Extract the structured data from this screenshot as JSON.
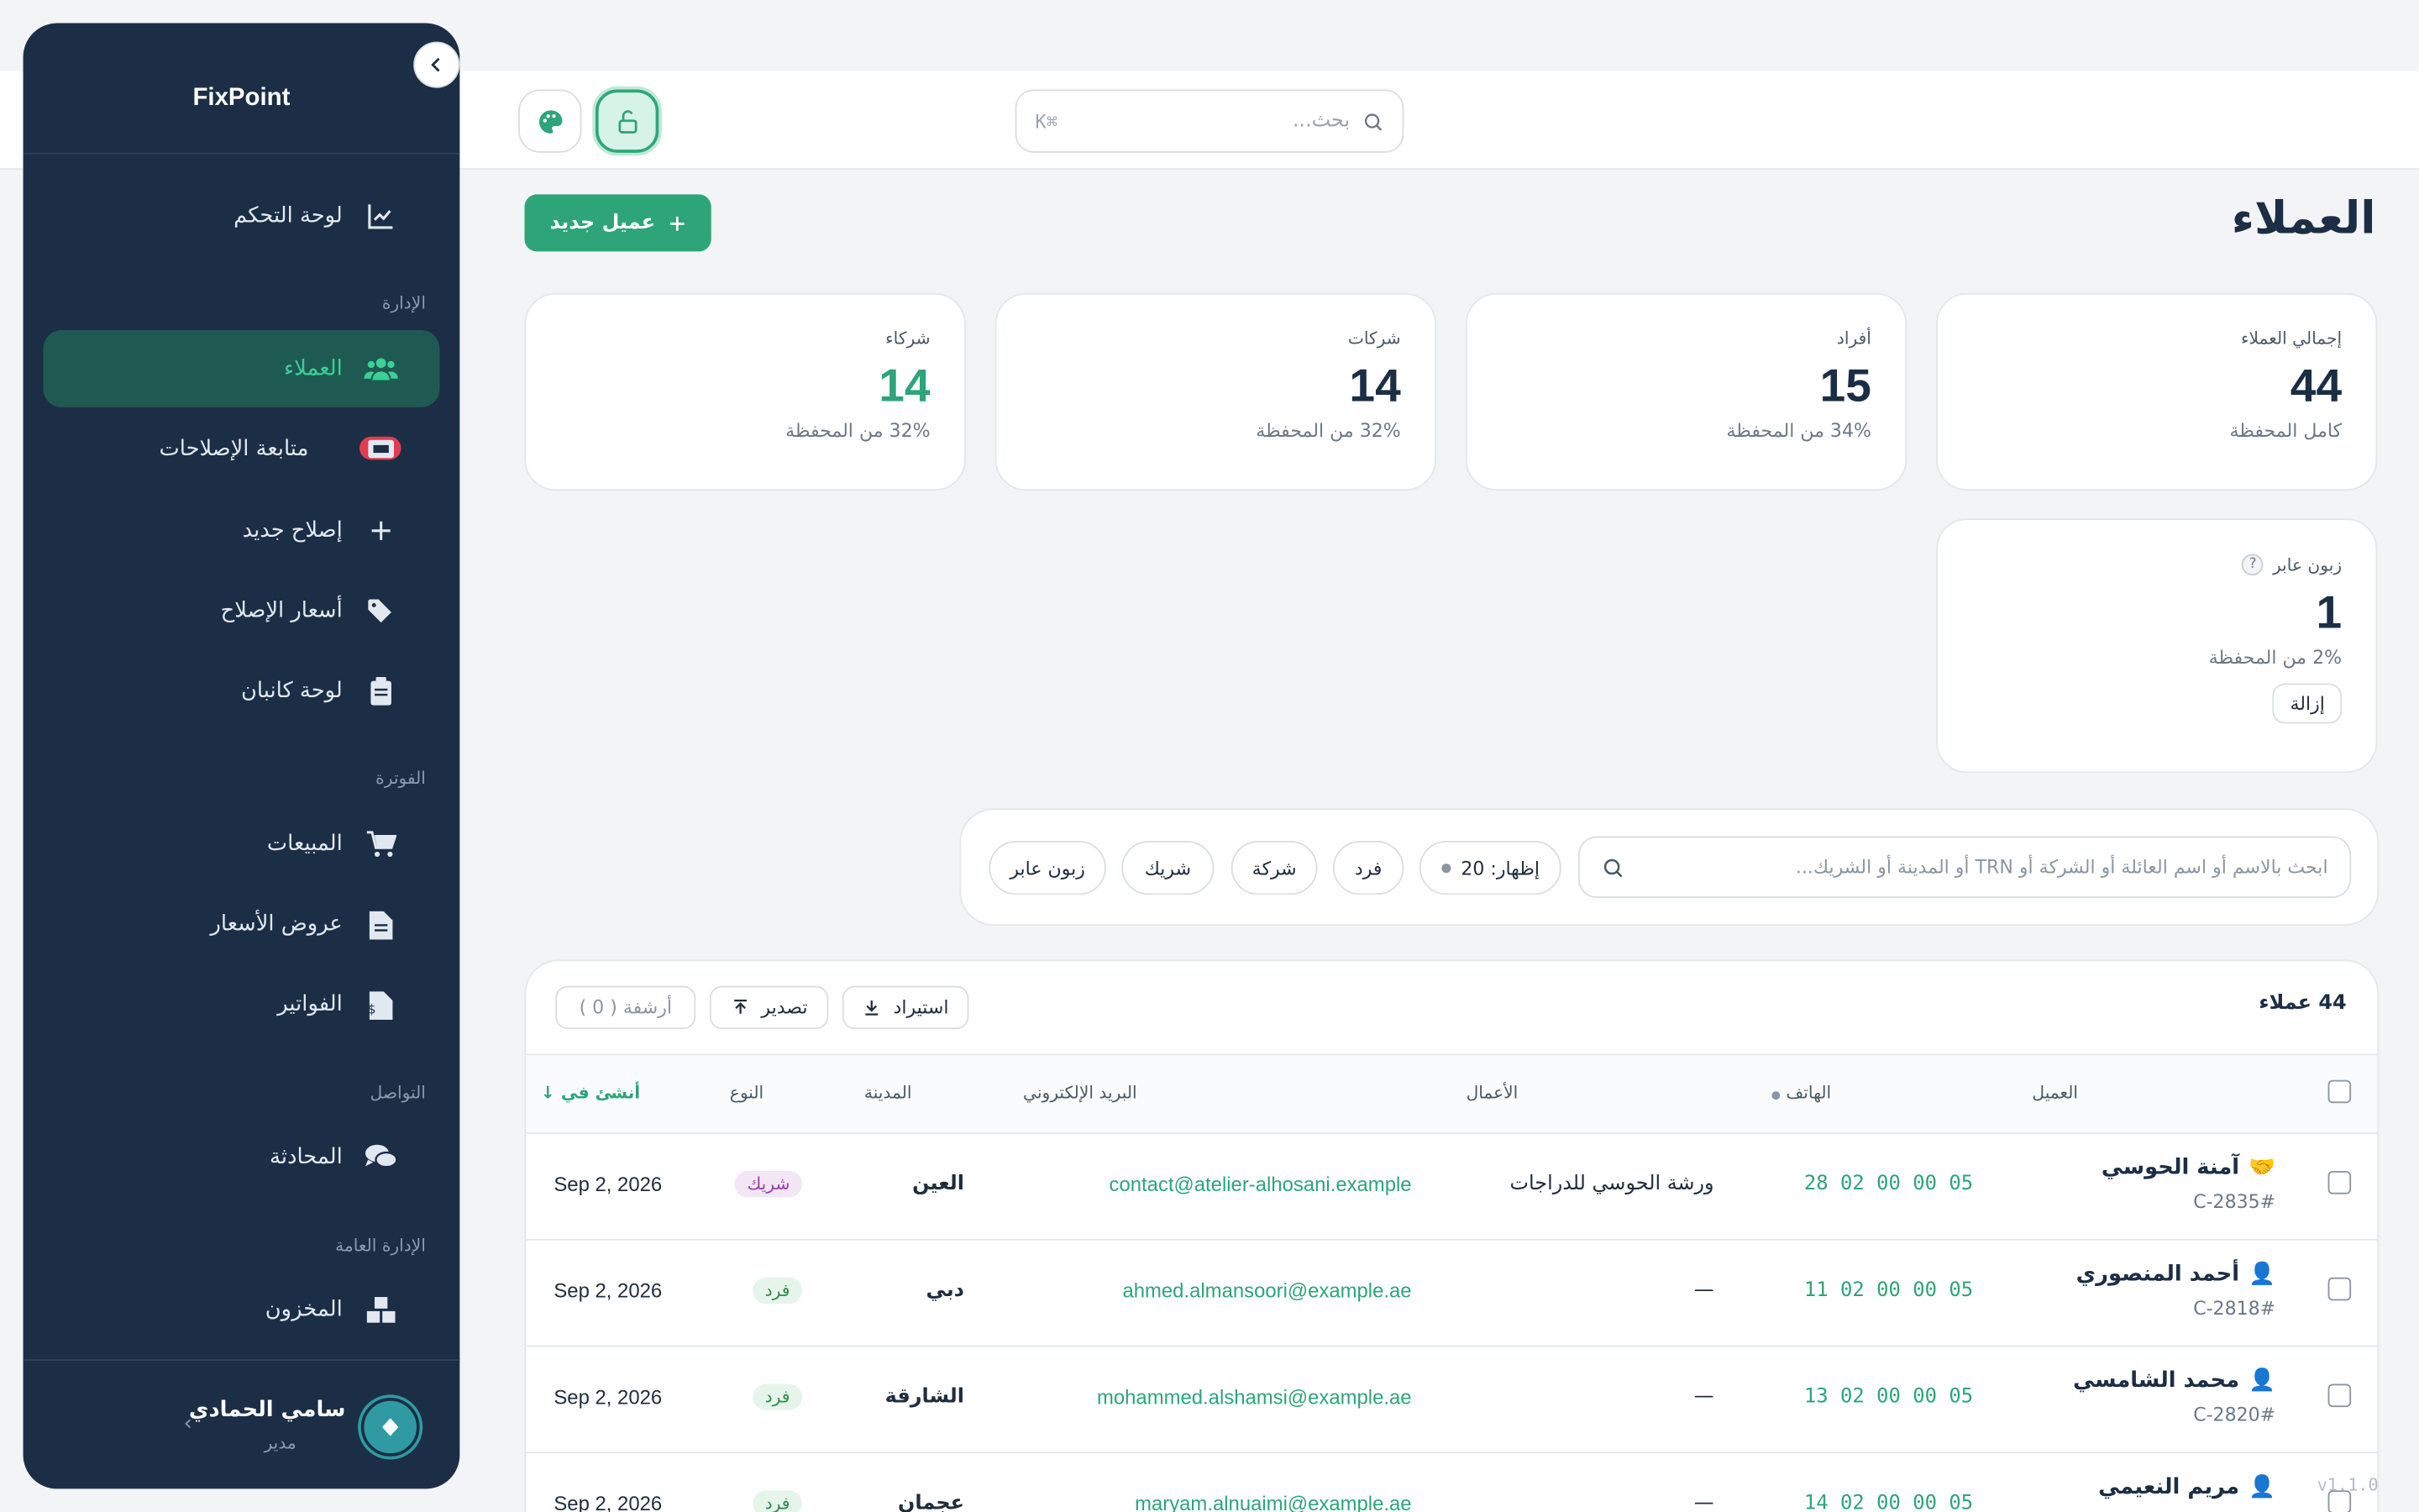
{
  "app": {
    "brand": "FixPoint",
    "version": "v1.1.0"
  },
  "topbar": {
    "search_placeholder": "بحث...",
    "search_shortcut": "K⌘"
  },
  "sidebar": {
    "dashboard": "لوحة التحكم",
    "section_admin": "الإدارة",
    "clients": "العملاء",
    "repair_tracking": "متابعة الإصلاحات",
    "repair_tracking_badge": "13",
    "new_repair": "إصلاح جديد",
    "repair_prices": "أسعار الإصلاح",
    "kanban": "لوحة كانبان",
    "section_billing": "الفوترة",
    "sales": "المبيعات",
    "quotes": "عروض الأسعار",
    "invoices": "الفواتير",
    "section_comm": "التواصل",
    "chat": "المحادثة",
    "section_general": "الإدارة العامة",
    "inventory": "المخزون",
    "user_name": "سامي الحمادي",
    "user_role": "مدير"
  },
  "page": {
    "title": "العملاء",
    "new_button": "عميل جديد"
  },
  "stats": [
    {
      "label": "إجمالي العملاء",
      "value": "44",
      "sub": "كامل المحفظة"
    },
    {
      "label": "أفراد",
      "value": "15",
      "sub": "34% من المحفظة"
    },
    {
      "label": "شركات",
      "value": "14",
      "sub": "32% من المحفظة"
    },
    {
      "label": "شركاء",
      "value": "14",
      "sub": "32% من المحفظة"
    },
    {
      "label": "زبون عابر",
      "value": "1",
      "sub": "2% من المحفظة",
      "action": "إزالة"
    }
  ],
  "filters": {
    "search_placeholder": "ابحث بالاسم أو اسم العائلة أو الشركة أو TRN أو المدينة أو الشريك...",
    "show": "إظهار: 20",
    "chips": [
      "فرد",
      "شركة",
      "شريك",
      "زبون عابر"
    ]
  },
  "table": {
    "count": "44 عملاء",
    "import": "استيراد",
    "export": "تصدير",
    "archive": "أرشفة ( 0 )",
    "headers": {
      "client": "العميل",
      "phone": "الهاتف",
      "business": "الأعمال",
      "email": "البريد الإلكتروني",
      "city": "المدينة",
      "type": "النوع",
      "created": "أنشئ في"
    },
    "rows": [
      {
        "name": "آمنة الحوسي",
        "code": "C-2835#",
        "phone": "28 02 00 00 05",
        "business": "ورشة الحوسي للدراجات",
        "email": "contact@atelier-alhosani.example",
        "city": "العين",
        "type": "شريك",
        "date": "Sep 2, 2026"
      },
      {
        "name": "أحمد المنصوري",
        "code": "C-2818#",
        "phone": "11 02 00 00 05",
        "business": "—",
        "email": "ahmed.almansoori@example.ae",
        "city": "دبي",
        "type": "فرد",
        "date": "Sep 2, 2026"
      },
      {
        "name": "محمد الشامسي",
        "code": "C-2820#",
        "phone": "13 02 00 00 05",
        "business": "—",
        "email": "mohammed.alshamsi@example.ae",
        "city": "الشارقة",
        "type": "فرد",
        "date": "Sep 2, 2026"
      },
      {
        "name": "مريم النعيمي",
        "code": "",
        "phone": "14 02 00 00 05",
        "business": "—",
        "email": "maryam.alnuaimi@example.ae",
        "city": "عجمان",
        "type": "فرد",
        "date": "Sep 2, 2026"
      }
    ]
  },
  "colors": {
    "accent": "#2da579",
    "sidebar_bg": "#1b2e45",
    "active_bg": "#1f5a52",
    "badge": "#e23b4e"
  }
}
